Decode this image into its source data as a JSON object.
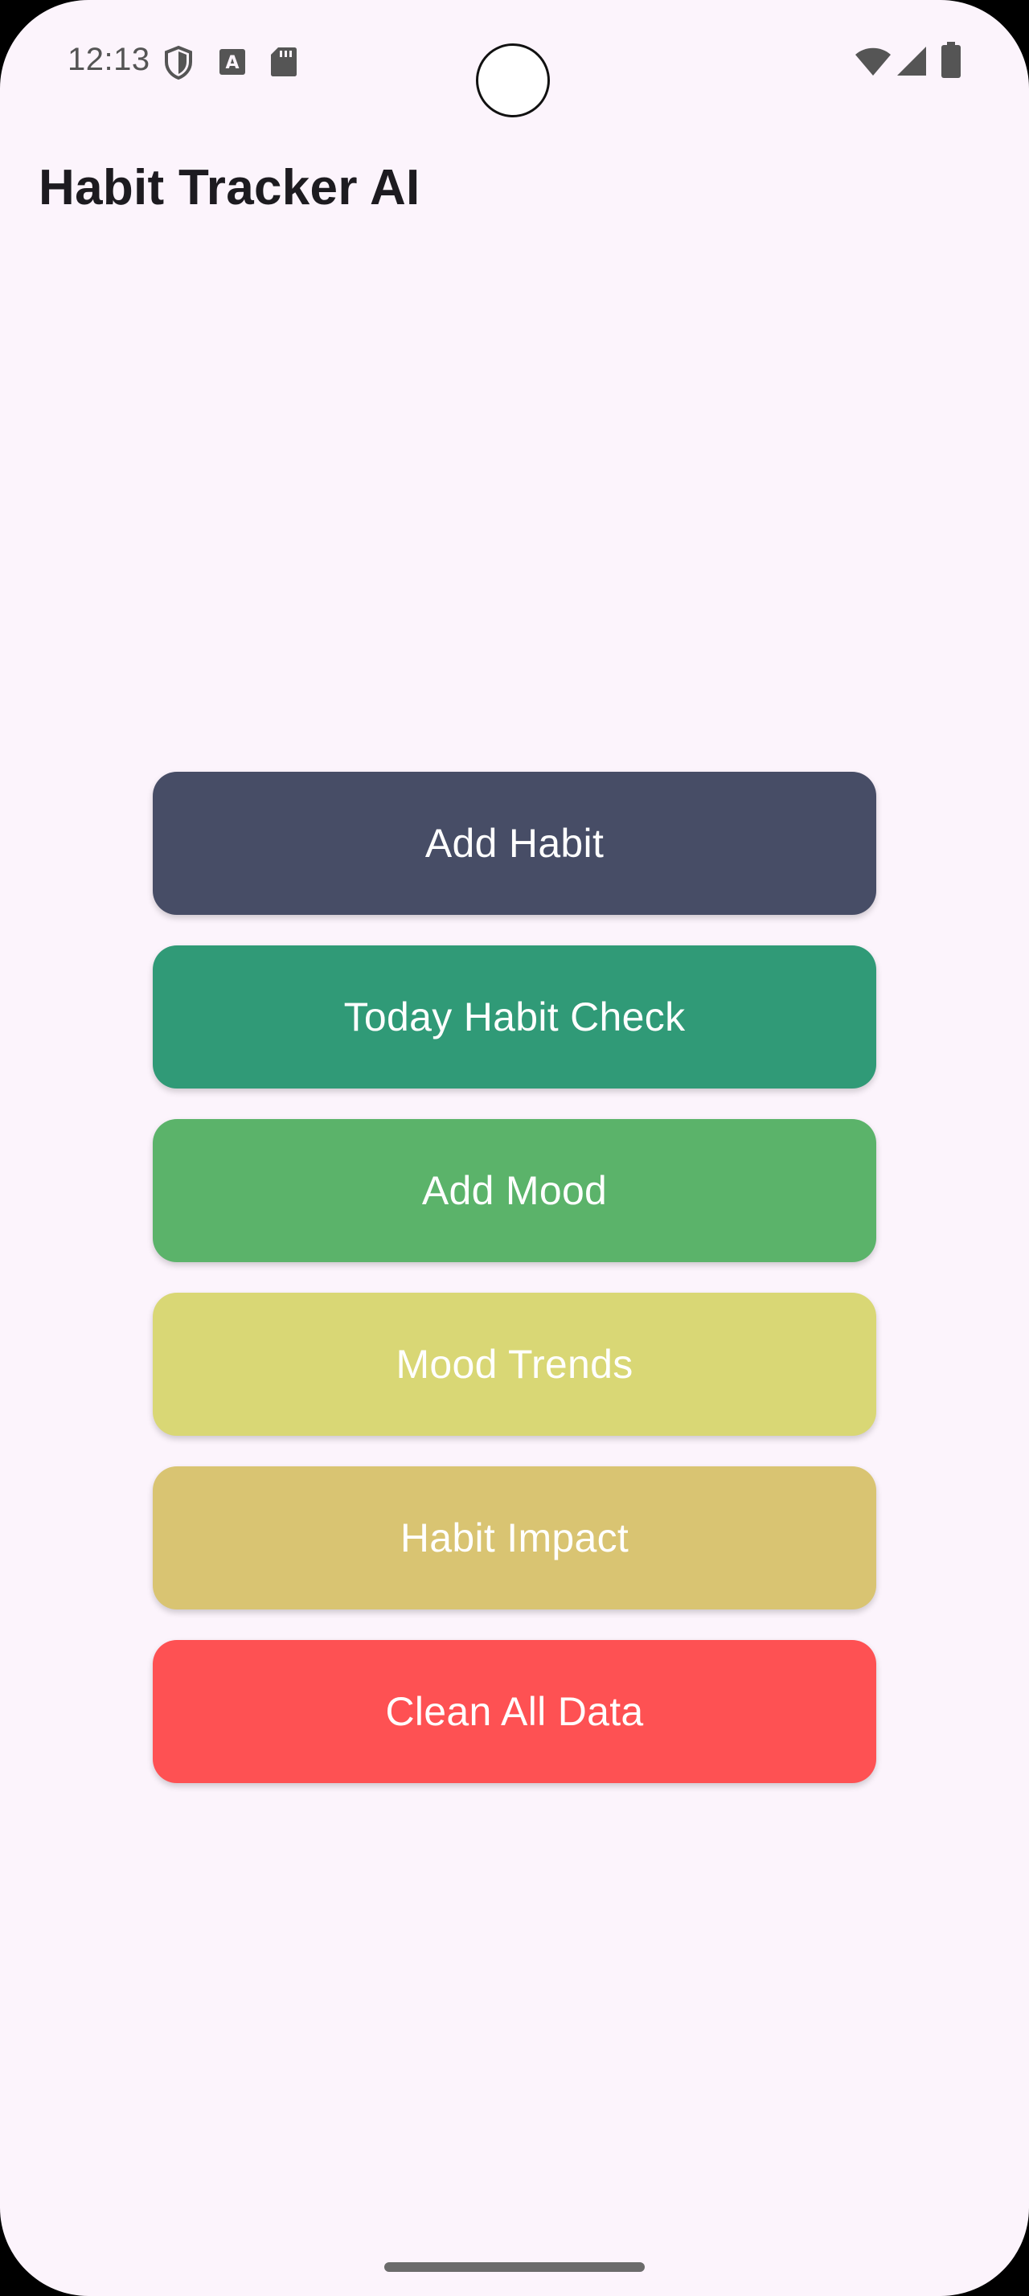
{
  "status_bar": {
    "time": "12:13",
    "left_icons": [
      "shield-icon",
      "text-a-icon",
      "sd-card-icon"
    ],
    "right_icons": [
      "wifi-icon",
      "signal-icon",
      "battery-icon"
    ]
  },
  "app": {
    "title": "Habit Tracker AI"
  },
  "buttons": [
    {
      "label": "Add Habit",
      "color": "#474d66"
    },
    {
      "label": "Today Habit Check",
      "color": "#309a77"
    },
    {
      "label": "Add Mood",
      "color": "#5bb36a"
    },
    {
      "label": "Mood Trends",
      "color": "#d9d775"
    },
    {
      "label": "Habit Impact",
      "color": "#d9c472"
    },
    {
      "label": "Clean All Data",
      "color": "#fe5153"
    }
  ]
}
